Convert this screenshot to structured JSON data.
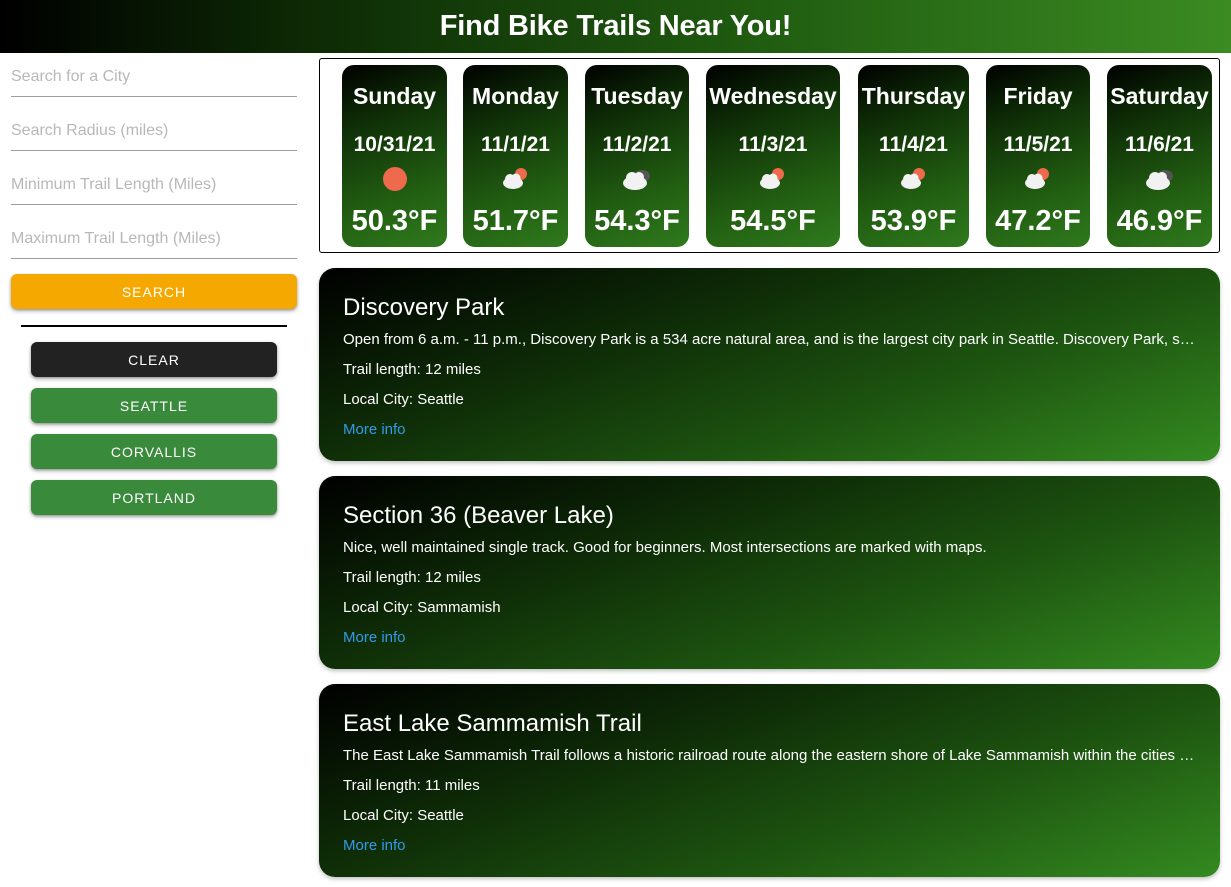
{
  "header": {
    "title": "Find Bike Trails Near You!"
  },
  "sidebar": {
    "city_placeholder": "Search for a City",
    "radius_placeholder": "Search Radius (miles)",
    "min_length_placeholder": "Minimum Trail Length (Miles)",
    "max_length_placeholder": "Maximum Trail Length (Miles)",
    "search_label": "SEARCH",
    "clear_label": "CLEAR",
    "cities": [
      "SEATTLE",
      "CORVALLIS",
      "PORTLAND"
    ]
  },
  "forecast": [
    {
      "day": "Sunday",
      "date": "10/31/21",
      "icon": "sun-icon",
      "temp": "50.3°F"
    },
    {
      "day": "Monday",
      "date": "11/1/21",
      "icon": "partly-cloudy-icon",
      "temp": "51.7°F"
    },
    {
      "day": "Tuesday",
      "date": "11/2/21",
      "icon": "cloudy-icon",
      "temp": "54.3°F"
    },
    {
      "day": "Wednesday",
      "date": "11/3/21",
      "icon": "partly-cloudy-icon",
      "temp": "54.5°F"
    },
    {
      "day": "Thursday",
      "date": "11/4/21",
      "icon": "partly-cloudy-icon",
      "temp": "53.9°F"
    },
    {
      "day": "Friday",
      "date": "11/5/21",
      "icon": "partly-cloudy-icon",
      "temp": "47.2°F"
    },
    {
      "day": "Saturday",
      "date": "11/6/21",
      "icon": "cloudy-icon",
      "temp": "46.9°F"
    }
  ],
  "trails": [
    {
      "name": "Discovery Park",
      "description": "Open from 6 a.m. - 11 p.m., Discovery Park is a 534 acre natural area, and is the largest city park in Seattle. Discovery Park, s…",
      "length": "Trail length: 12 miles",
      "city": "Local City: Seattle",
      "more": "More info"
    },
    {
      "name": "Section 36 (Beaver Lake)",
      "description": "Nice, well maintained single track. Good for beginners. Most intersections are marked with maps.",
      "length": "Trail length: 12 miles",
      "city": "Local City: Sammamish",
      "more": "More info"
    },
    {
      "name": "East Lake Sammamish Trail",
      "description": "The East Lake Sammamish Trail follows a historic railroad route along the eastern shore of Lake Sammamish within the cities …",
      "length": "Trail length: 11 miles",
      "city": "Local City: Seattle",
      "more": "More info"
    }
  ],
  "colors": {
    "search_button": "#f5a800",
    "clear_button": "#222222",
    "city_button": "#3a8a3b",
    "link": "#2f9be7",
    "sun": "#ee6a4c"
  }
}
